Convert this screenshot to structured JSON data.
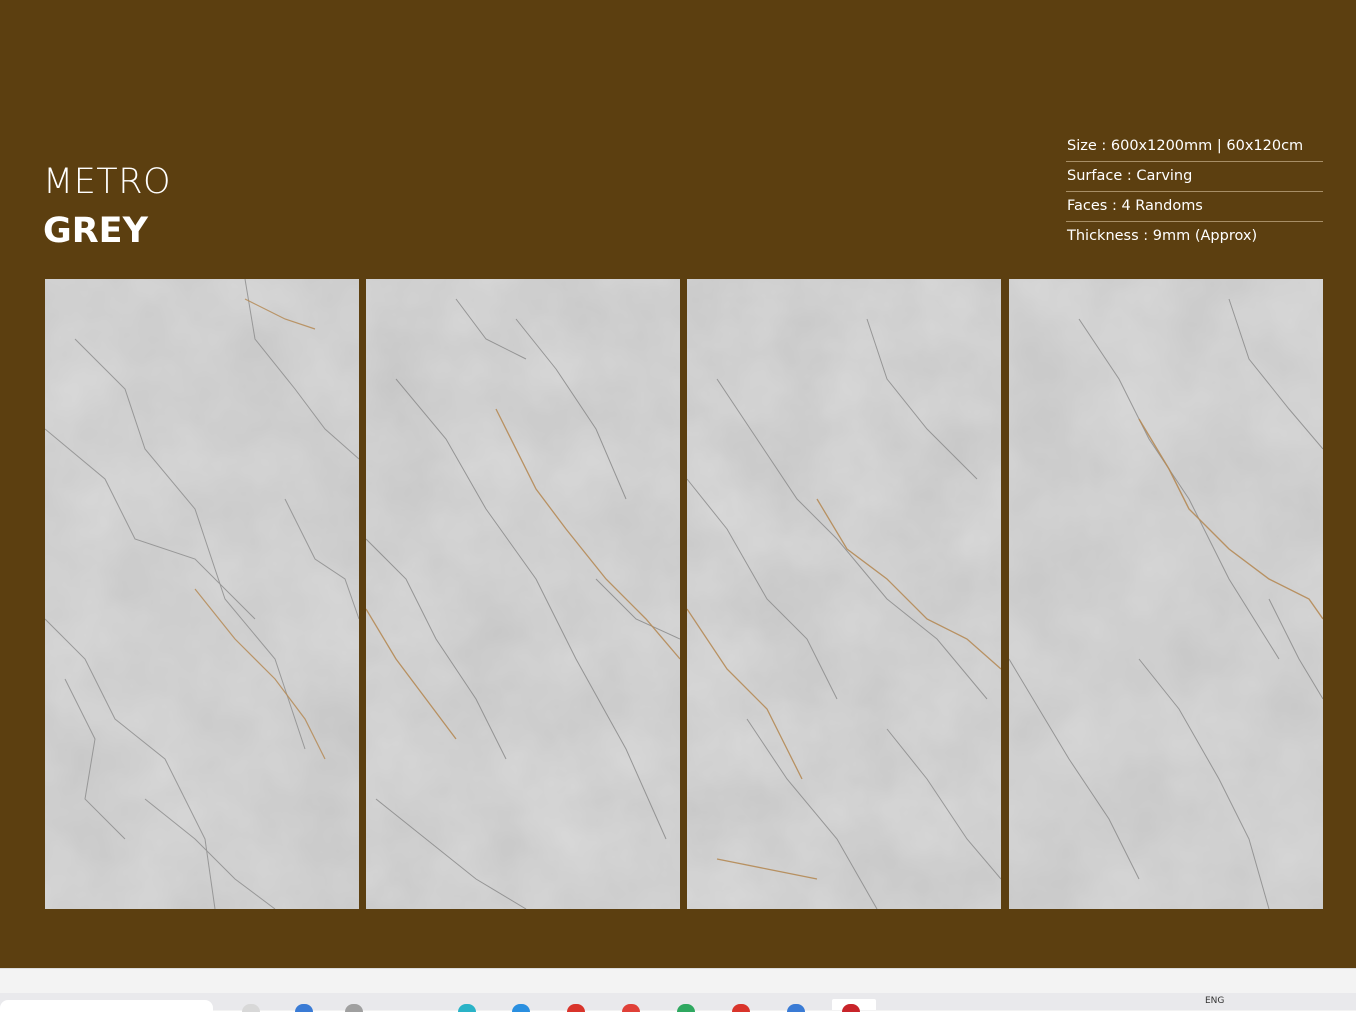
{
  "product": {
    "name_line1": "METRO",
    "name_line2": "GREY"
  },
  "specs": [
    {
      "label": "Size : 600x1200mm | 60x120cm"
    },
    {
      "label": "Surface : Carving"
    },
    {
      "label": "Faces : 4 Randoms"
    },
    {
      "label": "Thickness : 9mm (Approx)"
    }
  ],
  "colors": {
    "background": "#5c3f10",
    "text": "#ffffff",
    "marble_base": "#c4c4c4",
    "vein_dark": "#7b7b7b",
    "vein_gold": "#b58a55"
  },
  "tiles": [
    {
      "name": "face-1"
    },
    {
      "name": "face-2"
    },
    {
      "name": "face-3"
    },
    {
      "name": "face-4"
    }
  ],
  "taskbar": {
    "language": "ENG",
    "icons": [
      "search-box",
      "app-icon",
      "app-icon",
      "app-icon",
      "app-icon",
      "app-icon",
      "app-icon",
      "app-icon",
      "app-icon",
      "app-icon",
      "app-icon",
      "app-icon"
    ]
  }
}
